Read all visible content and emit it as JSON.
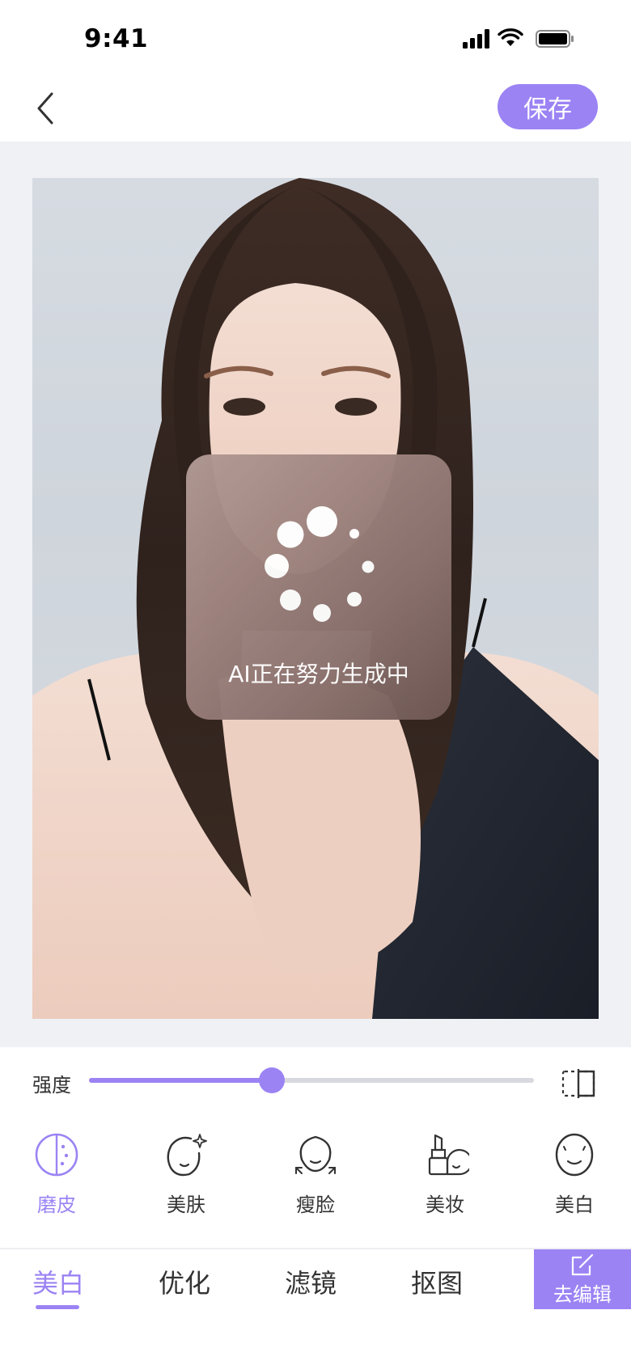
{
  "status_bar": {
    "time": "9:41"
  },
  "header": {
    "save_label": "保存"
  },
  "loading": {
    "text": "AI正在努力生成中"
  },
  "intensity": {
    "label": "强度",
    "value_fraction": 0.41
  },
  "tools": [
    {
      "label": "磨皮",
      "icon": "skin-smooth-icon",
      "active": true
    },
    {
      "label": "美肤",
      "icon": "skin-beauty-icon",
      "active": false
    },
    {
      "label": "瘦脸",
      "icon": "slim-face-icon",
      "active": false
    },
    {
      "label": "美妆",
      "icon": "makeup-icon",
      "active": false
    },
    {
      "label": "美白",
      "icon": "whitening-icon",
      "active": false
    }
  ],
  "tabs": [
    {
      "label": "美白",
      "active": true
    },
    {
      "label": "优化",
      "active": false
    },
    {
      "label": "滤镜",
      "active": false
    },
    {
      "label": "抠图",
      "active": false
    }
  ],
  "edit_button": {
    "label": "去编辑",
    "icon": "edit-icon"
  },
  "colors": {
    "accent": "#9b83f4",
    "canvas_bg": "#eff1f5"
  }
}
